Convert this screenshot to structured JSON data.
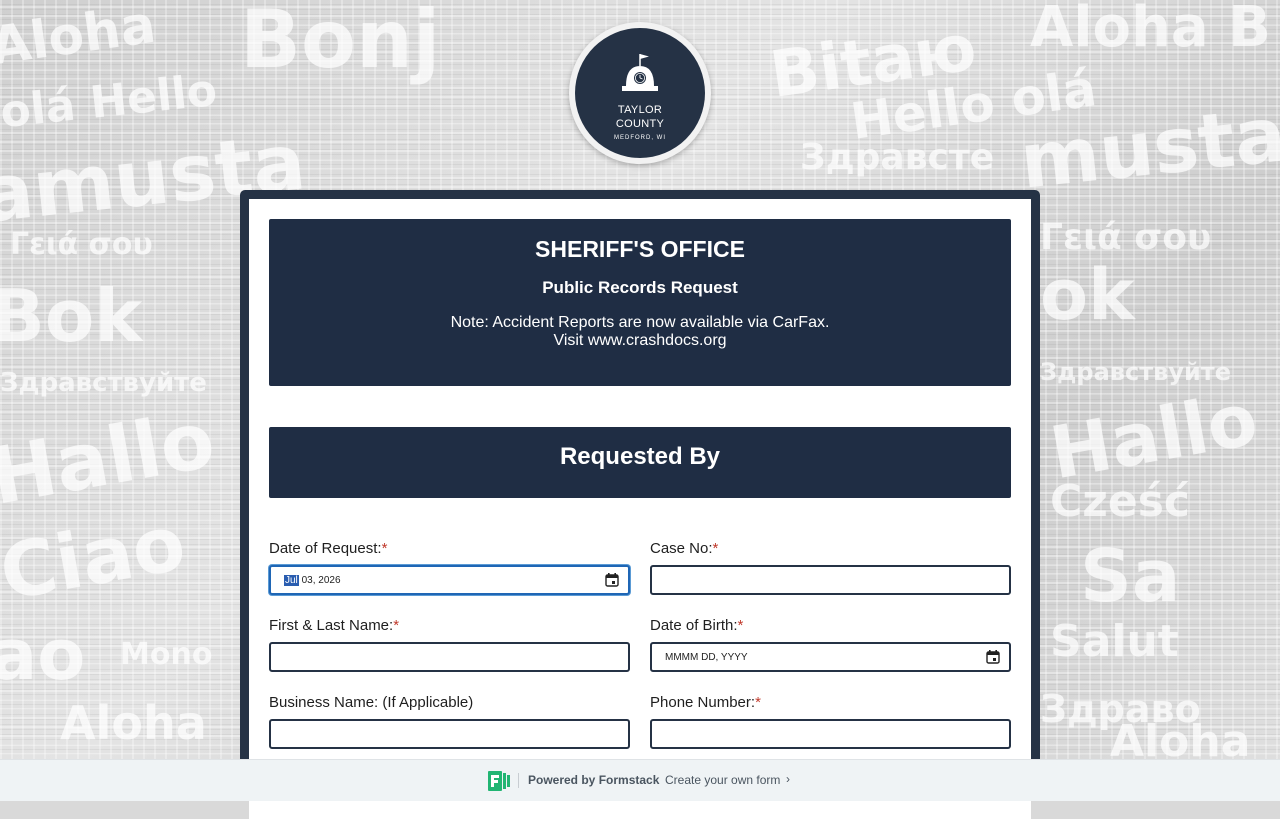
{
  "logo": {
    "line1": "TAYLOR",
    "line2": "COUNTY",
    "line3": "MEDFORD, WI",
    "icon": "capitol-clock-icon"
  },
  "header": {
    "title": "SHERIFF'S OFFICE",
    "subtitle": "Public Records Request",
    "note_line1": "Note:  Accident Reports are now available via CarFax.",
    "note_line2": "Visit www.crashdocs.org"
  },
  "section": {
    "title": "Requested By"
  },
  "fields": {
    "date_of_request": {
      "label": "Date of Request:",
      "required_mark": "*",
      "value_highlight": "Jul",
      "value_rest": " 03, 2026",
      "icon": "calendar-icon"
    },
    "case_no": {
      "label": "Case No:",
      "required_mark": "*",
      "value": ""
    },
    "first_last_name": {
      "label": "First & Last Name:",
      "required_mark": "*",
      "value": ""
    },
    "date_of_birth": {
      "label": "Date of Birth:",
      "required_mark": "*",
      "placeholder": "MMMM DD, YYYY",
      "icon": "calendar-icon"
    },
    "business_name": {
      "label": "Business Name: (If Applicable)",
      "value": ""
    },
    "phone_number": {
      "label": "Phone Number:",
      "required_mark": "*",
      "value": ""
    }
  },
  "footer": {
    "powered_by": "Powered by Formstack",
    "create_link": "Create your own form",
    "chevron": "›",
    "icon": "formstack-logo-icon"
  },
  "colors": {
    "navy": "#1f2d44",
    "frame": "#253245",
    "required": "#c0392b",
    "focus": "#1f66b5",
    "formstack_green": "#21b573"
  }
}
